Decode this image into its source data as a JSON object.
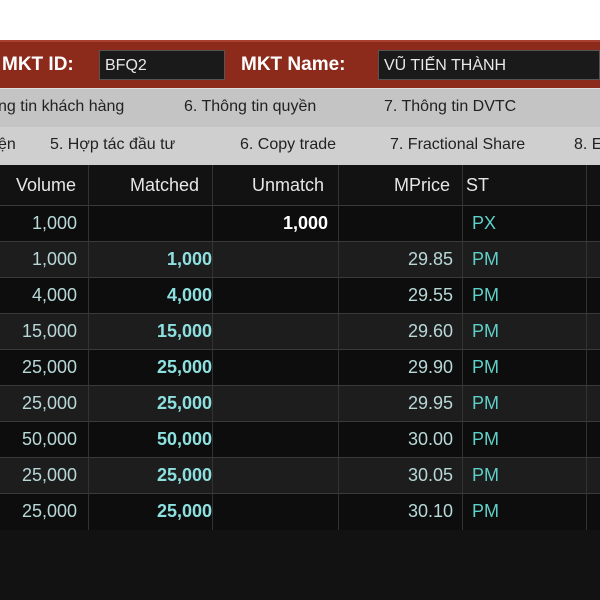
{
  "header": {
    "mkt_id_label": "MKT ID:",
    "mkt_id_value": "BFQ2",
    "mkt_name_label": "MKT Name:",
    "mkt_name_value": "VŨ TIẾN THÀNH"
  },
  "tabs_row1": [
    "ng tin khách hàng",
    "6. Thông tin quyền",
    "7. Thông tin DVTC"
  ],
  "tabs_row2": [
    "ện",
    "5. Hợp tác đầu tư",
    "6. Copy trade",
    "7. Fractional Share",
    "8. E"
  ],
  "table": {
    "columns": [
      "Volume",
      "Matched",
      "Unmatch",
      "MPrice",
      "ST"
    ],
    "rows": [
      {
        "volume": "1,000",
        "matched": "",
        "unmatch": "1,000",
        "mprice": "",
        "st": "PX"
      },
      {
        "volume": "1,000",
        "matched": "1,000",
        "unmatch": "",
        "mprice": "29.85",
        "st": "PM"
      },
      {
        "volume": "4,000",
        "matched": "4,000",
        "unmatch": "",
        "mprice": "29.55",
        "st": "PM"
      },
      {
        "volume": "15,000",
        "matched": "15,000",
        "unmatch": "",
        "mprice": "29.60",
        "st": "PM"
      },
      {
        "volume": "25,000",
        "matched": "25,000",
        "unmatch": "",
        "mprice": "29.90",
        "st": "PM"
      },
      {
        "volume": "25,000",
        "matched": "25,000",
        "unmatch": "",
        "mprice": "29.95",
        "st": "PM"
      },
      {
        "volume": "50,000",
        "matched": "50,000",
        "unmatch": "",
        "mprice": "30.00",
        "st": "PM"
      },
      {
        "volume": "25,000",
        "matched": "25,000",
        "unmatch": "",
        "mprice": "30.05",
        "st": "PM"
      },
      {
        "volume": "25,000",
        "matched": "25,000",
        "unmatch": "",
        "mprice": "30.10",
        "st": "PM"
      }
    ]
  },
  "colors": {
    "header_bg": "#8c2a1c",
    "grid_bg": "#121212",
    "status_text": "#5fd0c8",
    "matched_text": "#8ee0e0"
  }
}
